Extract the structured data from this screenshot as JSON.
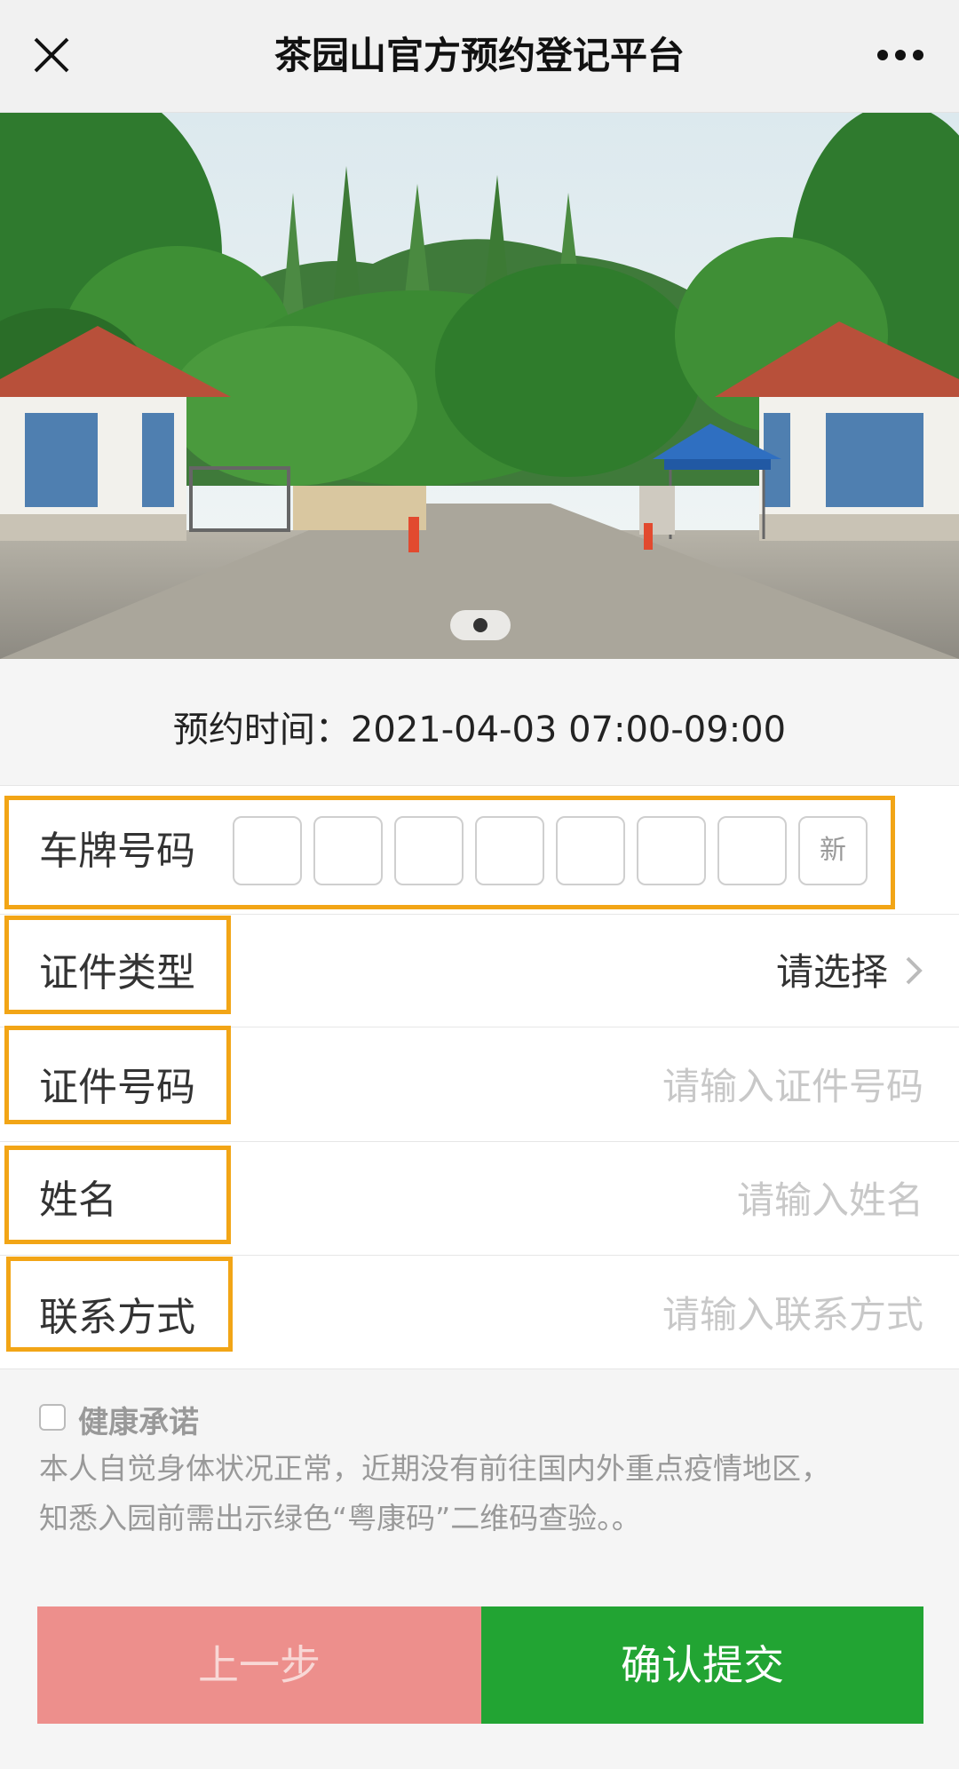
{
  "nav": {
    "title": "茶园山官方预约登记平台"
  },
  "carousel": {
    "image": "park-entrance-gate-photo",
    "pages": 1,
    "active": 1
  },
  "reservation": {
    "time_text": "预约时间：2021-04-03 07:00-09:00"
  },
  "form": {
    "plate": {
      "label": "车牌号码",
      "new_energy_label": "新"
    },
    "id_type": {
      "label": "证件类型",
      "value": "请选择"
    },
    "id_number": {
      "label": "证件号码",
      "placeholder": "请输入证件号码"
    },
    "name": {
      "label": "姓名",
      "placeholder": "请输入姓名"
    },
    "contact": {
      "label": "联系方式",
      "placeholder": "请输入联系方式"
    }
  },
  "health": {
    "title": "健康承诺",
    "line1": "本人自觉身体状况正常，近期没有前往国内外重点疫情地区，",
    "line2": "知悉入园前需出示绿色“粤康码”二维码查验。。"
  },
  "buttons": {
    "prev": "上一步",
    "submit": "确认提交"
  },
  "colors": {
    "highlight": "#f2a516",
    "submit": "#22a433",
    "prev": "#ed8f8c"
  }
}
